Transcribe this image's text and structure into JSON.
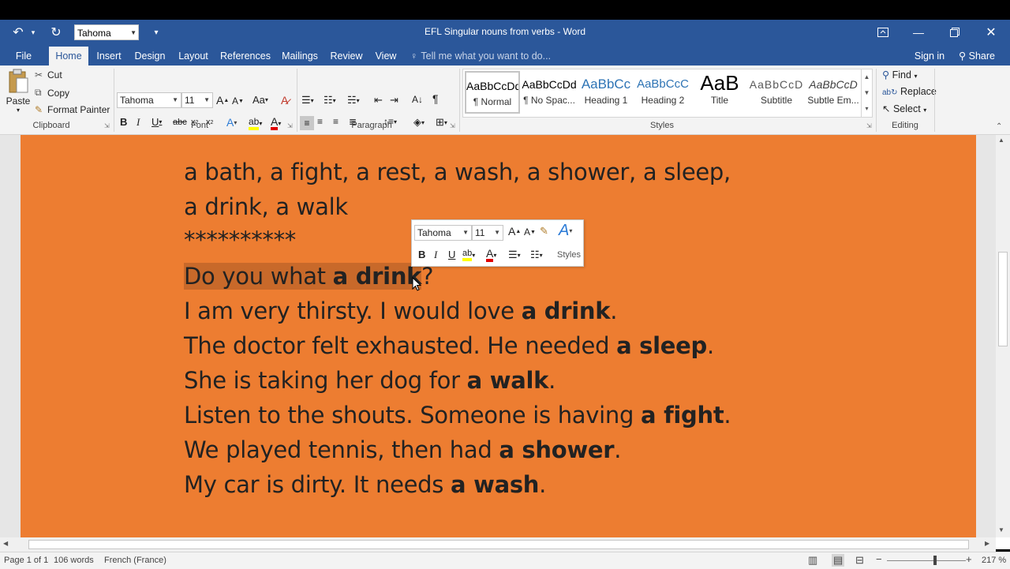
{
  "window": {
    "title": "EFL Singular nouns from verbs - Word",
    "quick_font": "Tahoma"
  },
  "tabs": [
    "File",
    "Home",
    "Insert",
    "Design",
    "Layout",
    "References",
    "Mailings",
    "Review",
    "View"
  ],
  "tell_me": "Tell me what you want to do...",
  "account": {
    "sign_in": "Sign in",
    "share": "Share"
  },
  "clipboard": {
    "paste": "Paste",
    "cut": "Cut",
    "copy": "Copy",
    "format_painter": "Format Painter",
    "label": "Clipboard"
  },
  "font": {
    "name": "Tahoma",
    "size": "11",
    "label": "Font"
  },
  "paragraph": {
    "label": "Paragraph"
  },
  "styles": {
    "label": "Styles",
    "items": [
      {
        "preview": "AaBbCcDd",
        "name": "¶ Normal"
      },
      {
        "preview": "AaBbCcDd",
        "name": "¶ No Spac..."
      },
      {
        "preview": "AaBbCc",
        "name": "Heading 1"
      },
      {
        "preview": "AaBbCcC",
        "name": "Heading 2"
      },
      {
        "preview": "AaB",
        "name": "Title"
      },
      {
        "preview": "AaBbCcD",
        "name": "Subtitle"
      },
      {
        "preview": "AaBbCcD",
        "name": "Subtle Em..."
      }
    ]
  },
  "editing": {
    "find": "Find",
    "replace": "Replace",
    "select": "Select",
    "label": "Editing"
  },
  "document": {
    "line1": "a bath, a fight, a rest, a wash, a shower, a sleep,",
    "line2": "a drink, a walk",
    "line3": "**********",
    "s1": {
      "pre": "Do you what ",
      "bold": "a drink",
      "post": "?"
    },
    "s2": {
      "pre": "I am very thirsty. I would love ",
      "bold": "a drink",
      "post": "."
    },
    "s3": {
      "pre": "The doctor felt exhausted. He needed ",
      "bold": "a sleep",
      "post": "."
    },
    "s4": {
      "pre": "She is taking her dog for ",
      "bold": "a walk",
      "post": "."
    },
    "s5": {
      "pre": "Listen to the shouts. Someone is having ",
      "bold": "a fight",
      "post": "."
    },
    "s6": {
      "pre": "We played tennis, then had ",
      "bold": "a shower",
      "post": "."
    },
    "s7": {
      "pre": "My car is dirty. It needs ",
      "bold": "a wash",
      "post": "."
    }
  },
  "mini_toolbar": {
    "font": "Tahoma",
    "size": "11",
    "styles": "Styles"
  },
  "status": {
    "page": "Page 1 of 1",
    "words": "106 words",
    "language": "French (France)",
    "zoom": "217 %"
  },
  "colors": {
    "titlebar": "#2b579a",
    "page": "#ed7d31",
    "highlight": "#c8692a"
  }
}
